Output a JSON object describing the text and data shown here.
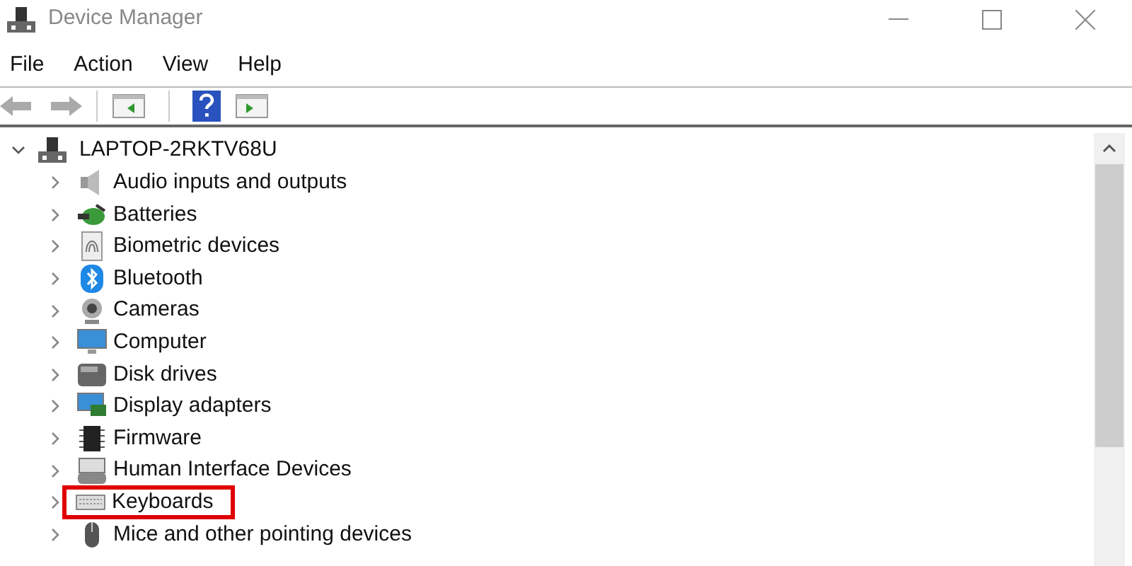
{
  "window": {
    "title": "Device Manager"
  },
  "menu": [
    "File",
    "Action",
    "View",
    "Help"
  ],
  "tree": {
    "label": "LAPTOP-2RKTV68U",
    "expanded": true,
    "children": [
      {
        "label": "Audio inputs and outputs",
        "expanded": false,
        "highlighted": false
      },
      {
        "label": "Batteries",
        "expanded": false,
        "highlighted": false
      },
      {
        "label": "Biometric devices",
        "expanded": false,
        "highlighted": false
      },
      {
        "label": "Bluetooth",
        "expanded": false,
        "highlighted": false
      },
      {
        "label": "Cameras",
        "expanded": false,
        "highlighted": false
      },
      {
        "label": "Computer",
        "expanded": false,
        "highlighted": false
      },
      {
        "label": "Disk drives",
        "expanded": false,
        "highlighted": false
      },
      {
        "label": "Display adapters",
        "expanded": false,
        "highlighted": false
      },
      {
        "label": "Firmware",
        "expanded": false,
        "highlighted": false
      },
      {
        "label": "Human Interface Devices",
        "expanded": false,
        "highlighted": false
      },
      {
        "label": "Keyboards",
        "expanded": false,
        "highlighted": true
      },
      {
        "label": "Mice and other pointing devices",
        "expanded": false,
        "highlighted": false
      }
    ]
  }
}
